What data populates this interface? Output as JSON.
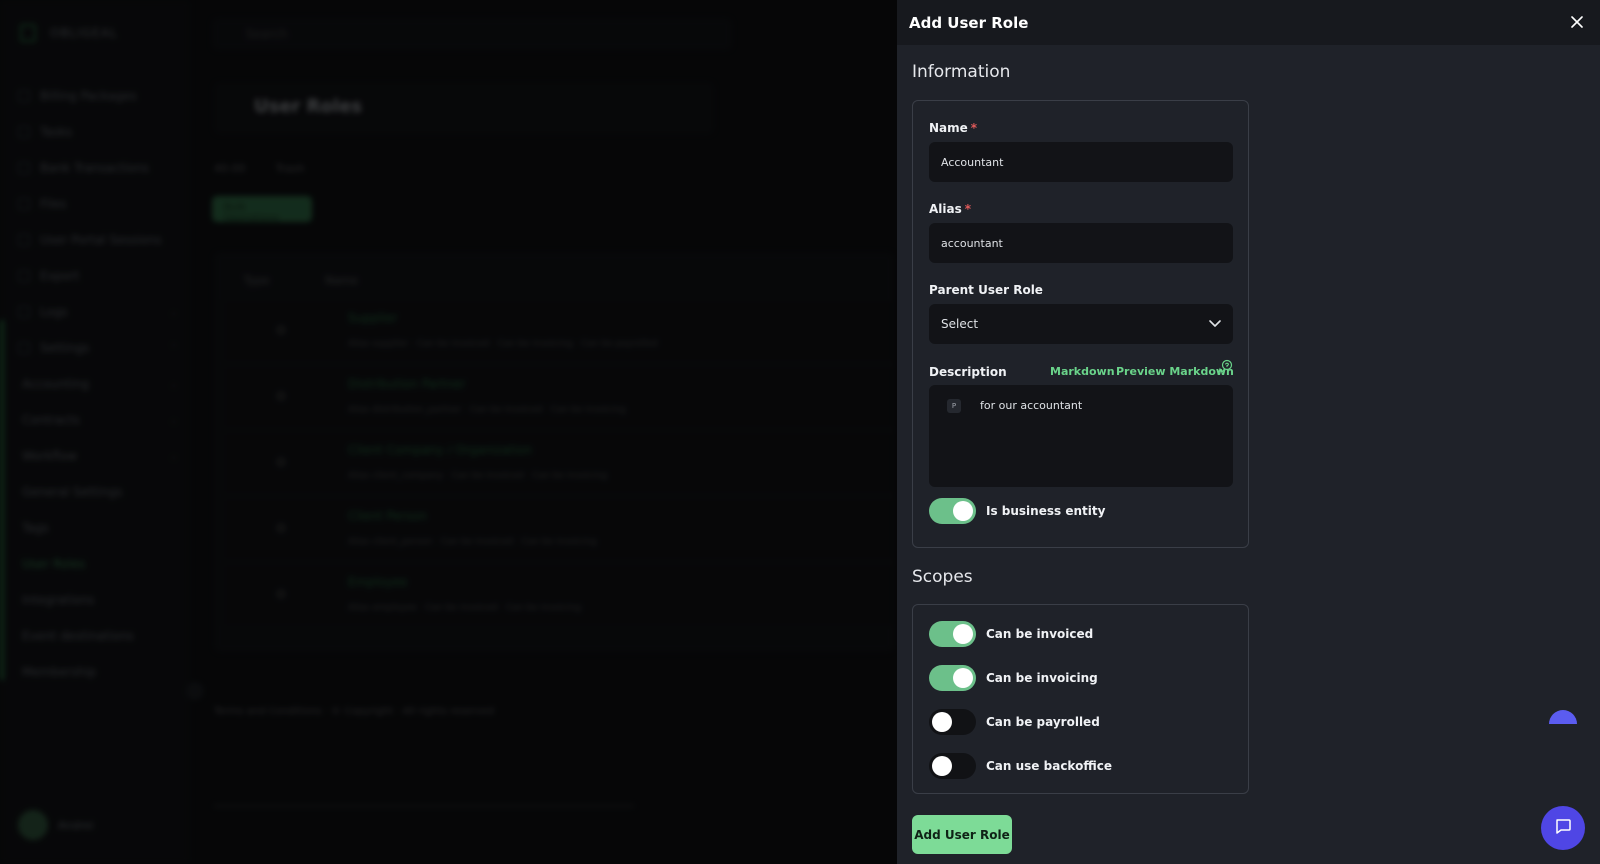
{
  "drawer": {
    "title": "Add User Role",
    "sections": {
      "information": "Information",
      "scopes": "Scopes"
    },
    "fields": {
      "name": {
        "label": "Name",
        "required_mark": "*",
        "value": "Accountant"
      },
      "alias": {
        "label": "Alias",
        "required_mark": "*",
        "value": "accountant"
      },
      "parent_role": {
        "label": "Parent User Role",
        "selected": "Select"
      },
      "description": {
        "label": "Description",
        "markdown_link": "Markdown",
        "preview_link": "Preview Markdown",
        "block_tag": "P",
        "value": "for our accountant"
      },
      "is_business_entity": {
        "label": "Is business entity",
        "on": true
      }
    },
    "scopes": [
      {
        "label": "Can be invoiced",
        "on": true
      },
      {
        "label": "Can be invoicing",
        "on": true
      },
      {
        "label": "Can be payrolled",
        "on": false
      },
      {
        "label": "Can use backoffice",
        "on": false
      }
    ],
    "submit_label": "Add User Role"
  },
  "colors": {
    "accent_green": "#7ddb97",
    "toggle_on": "#6cc08a",
    "chat_button": "#4f46e5",
    "drawer_bg": "#1f2229"
  },
  "icons": {
    "close": "close-icon",
    "chevron": "chevron-down-icon",
    "help": "help-icon",
    "chat": "chat-icon"
  }
}
